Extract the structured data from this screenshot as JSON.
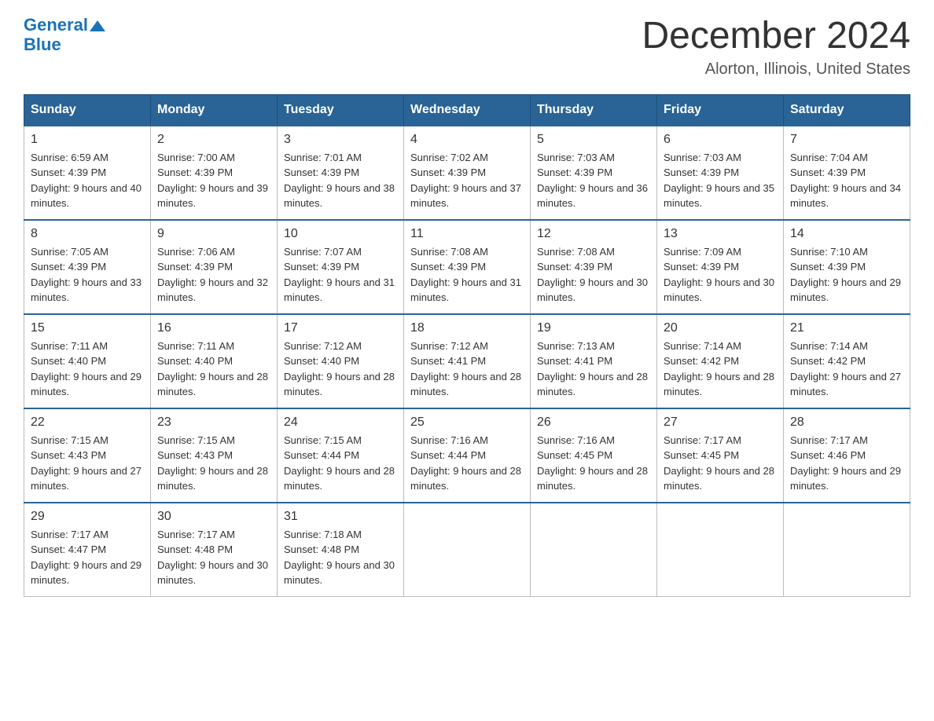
{
  "header": {
    "logo_general": "General",
    "logo_blue": "Blue",
    "title": "December 2024",
    "subtitle": "Alorton, Illinois, United States"
  },
  "weekdays": [
    "Sunday",
    "Monday",
    "Tuesday",
    "Wednesday",
    "Thursday",
    "Friday",
    "Saturday"
  ],
  "weeks": [
    [
      {
        "day": "1",
        "sunrise": "6:59 AM",
        "sunset": "4:39 PM",
        "daylight": "9 hours and 40 minutes."
      },
      {
        "day": "2",
        "sunrise": "7:00 AM",
        "sunset": "4:39 PM",
        "daylight": "9 hours and 39 minutes."
      },
      {
        "day": "3",
        "sunrise": "7:01 AM",
        "sunset": "4:39 PM",
        "daylight": "9 hours and 38 minutes."
      },
      {
        "day": "4",
        "sunrise": "7:02 AM",
        "sunset": "4:39 PM",
        "daylight": "9 hours and 37 minutes."
      },
      {
        "day": "5",
        "sunrise": "7:03 AM",
        "sunset": "4:39 PM",
        "daylight": "9 hours and 36 minutes."
      },
      {
        "day": "6",
        "sunrise": "7:03 AM",
        "sunset": "4:39 PM",
        "daylight": "9 hours and 35 minutes."
      },
      {
        "day": "7",
        "sunrise": "7:04 AM",
        "sunset": "4:39 PM",
        "daylight": "9 hours and 34 minutes."
      }
    ],
    [
      {
        "day": "8",
        "sunrise": "7:05 AM",
        "sunset": "4:39 PM",
        "daylight": "9 hours and 33 minutes."
      },
      {
        "day": "9",
        "sunrise": "7:06 AM",
        "sunset": "4:39 PM",
        "daylight": "9 hours and 32 minutes."
      },
      {
        "day": "10",
        "sunrise": "7:07 AM",
        "sunset": "4:39 PM",
        "daylight": "9 hours and 31 minutes."
      },
      {
        "day": "11",
        "sunrise": "7:08 AM",
        "sunset": "4:39 PM",
        "daylight": "9 hours and 31 minutes."
      },
      {
        "day": "12",
        "sunrise": "7:08 AM",
        "sunset": "4:39 PM",
        "daylight": "9 hours and 30 minutes."
      },
      {
        "day": "13",
        "sunrise": "7:09 AM",
        "sunset": "4:39 PM",
        "daylight": "9 hours and 30 minutes."
      },
      {
        "day": "14",
        "sunrise": "7:10 AM",
        "sunset": "4:39 PM",
        "daylight": "9 hours and 29 minutes."
      }
    ],
    [
      {
        "day": "15",
        "sunrise": "7:11 AM",
        "sunset": "4:40 PM",
        "daylight": "9 hours and 29 minutes."
      },
      {
        "day": "16",
        "sunrise": "7:11 AM",
        "sunset": "4:40 PM",
        "daylight": "9 hours and 28 minutes."
      },
      {
        "day": "17",
        "sunrise": "7:12 AM",
        "sunset": "4:40 PM",
        "daylight": "9 hours and 28 minutes."
      },
      {
        "day": "18",
        "sunrise": "7:12 AM",
        "sunset": "4:41 PM",
        "daylight": "9 hours and 28 minutes."
      },
      {
        "day": "19",
        "sunrise": "7:13 AM",
        "sunset": "4:41 PM",
        "daylight": "9 hours and 28 minutes."
      },
      {
        "day": "20",
        "sunrise": "7:14 AM",
        "sunset": "4:42 PM",
        "daylight": "9 hours and 28 minutes."
      },
      {
        "day": "21",
        "sunrise": "7:14 AM",
        "sunset": "4:42 PM",
        "daylight": "9 hours and 27 minutes."
      }
    ],
    [
      {
        "day": "22",
        "sunrise": "7:15 AM",
        "sunset": "4:43 PM",
        "daylight": "9 hours and 27 minutes."
      },
      {
        "day": "23",
        "sunrise": "7:15 AM",
        "sunset": "4:43 PM",
        "daylight": "9 hours and 28 minutes."
      },
      {
        "day": "24",
        "sunrise": "7:15 AM",
        "sunset": "4:44 PM",
        "daylight": "9 hours and 28 minutes."
      },
      {
        "day": "25",
        "sunrise": "7:16 AM",
        "sunset": "4:44 PM",
        "daylight": "9 hours and 28 minutes."
      },
      {
        "day": "26",
        "sunrise": "7:16 AM",
        "sunset": "4:45 PM",
        "daylight": "9 hours and 28 minutes."
      },
      {
        "day": "27",
        "sunrise": "7:17 AM",
        "sunset": "4:45 PM",
        "daylight": "9 hours and 28 minutes."
      },
      {
        "day": "28",
        "sunrise": "7:17 AM",
        "sunset": "4:46 PM",
        "daylight": "9 hours and 29 minutes."
      }
    ],
    [
      {
        "day": "29",
        "sunrise": "7:17 AM",
        "sunset": "4:47 PM",
        "daylight": "9 hours and 29 minutes."
      },
      {
        "day": "30",
        "sunrise": "7:17 AM",
        "sunset": "4:48 PM",
        "daylight": "9 hours and 30 minutes."
      },
      {
        "day": "31",
        "sunrise": "7:18 AM",
        "sunset": "4:48 PM",
        "daylight": "9 hours and 30 minutes."
      },
      null,
      null,
      null,
      null
    ]
  ]
}
